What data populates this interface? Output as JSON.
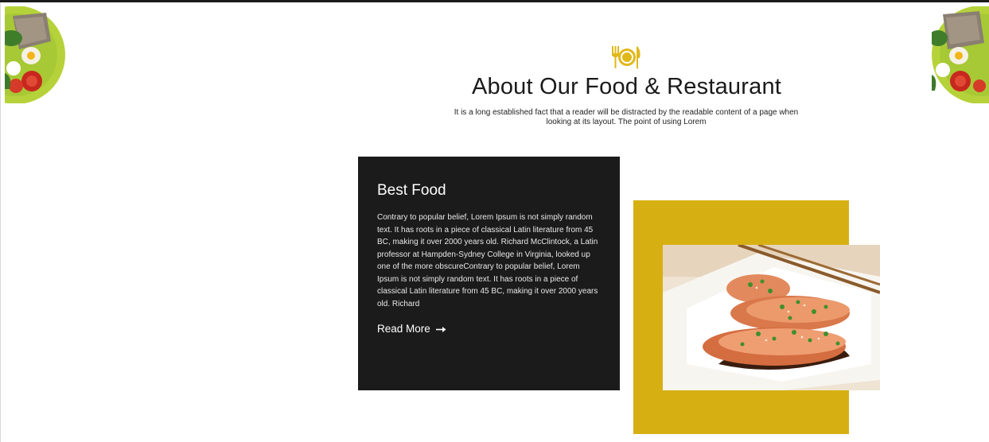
{
  "header": {
    "icon": "plate-cutlery-icon",
    "title": "About Our Food & Restaurant",
    "subtitle": "It is a long established fact that a reader will be distracted by the readable content of a page when looking at its layout. The point of using Lorem"
  },
  "card": {
    "title": "Best Food",
    "text": "Contrary to popular belief, Lorem Ipsum is not simply random text. It has roots in a piece of classical Latin literature from 45 BC, making it over 2000 years old. Richard McClintock, a Latin professor at Hampden-Sydney College in Virginia, looked up one of the more obscureContrary to popular belief, Lorem Ipsum is not simply random text. It has roots in a piece of classical Latin literature from 45 BC, making it over 2000 years old. Richard",
    "read_more": "Read More",
    "arrow_icon": "arrow-right-icon"
  },
  "images": {
    "plates": "salad-plate-image",
    "food": "grilled-salmon-image"
  },
  "colors": {
    "accent": "#d6b013",
    "card_bg": "#1b1b1b"
  }
}
